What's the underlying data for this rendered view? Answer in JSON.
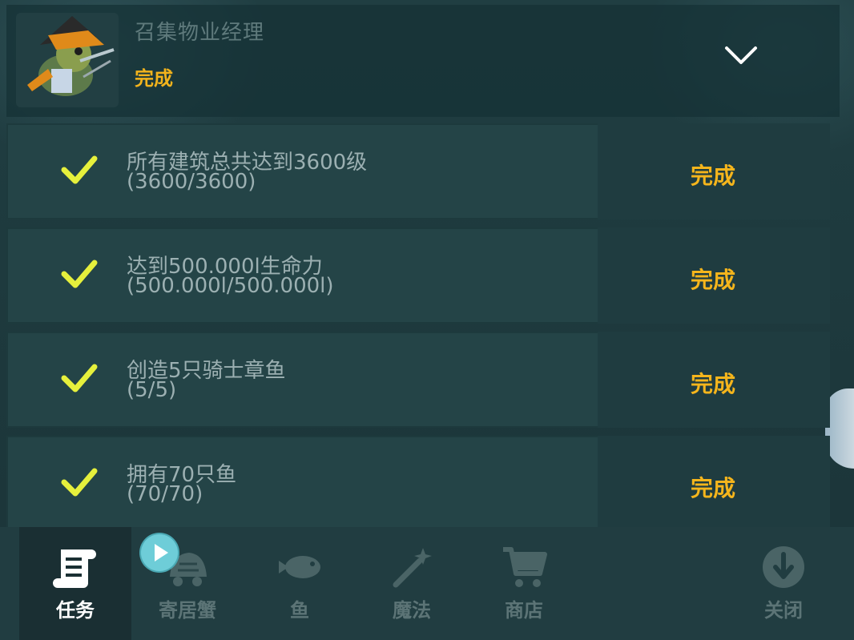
{
  "header": {
    "title": "召集物业经理",
    "status": "完成"
  },
  "tasks": [
    {
      "title": "所有建筑总共达到3600级",
      "progress": "(3600/3600)",
      "status": "完成"
    },
    {
      "title": "达到500.000l生命力",
      "progress": "(500.000l/500.000l)",
      "status": "完成"
    },
    {
      "title": "创造5只骑士章鱼",
      "progress": "(5/5)",
      "status": "完成"
    },
    {
      "title": "拥有70只鱼",
      "progress": "(70/70)",
      "status": "完成"
    }
  ],
  "nav": {
    "items": [
      {
        "label": "任务",
        "icon": "scroll-icon",
        "active": true
      },
      {
        "label": "寄居蟹",
        "icon": "hermit-crab-icon",
        "active": false
      },
      {
        "label": "鱼",
        "icon": "fish-icon",
        "active": false
      },
      {
        "label": "魔法",
        "icon": "magic-wand-icon",
        "active": false
      },
      {
        "label": "商店",
        "icon": "cart-icon",
        "active": false
      },
      {
        "label": "关闭",
        "icon": "close-download-icon",
        "active": false
      }
    ]
  },
  "colors": {
    "accent": "#f5b51c",
    "check": "#e6f03c",
    "play_badge": "#6ecdd8"
  }
}
